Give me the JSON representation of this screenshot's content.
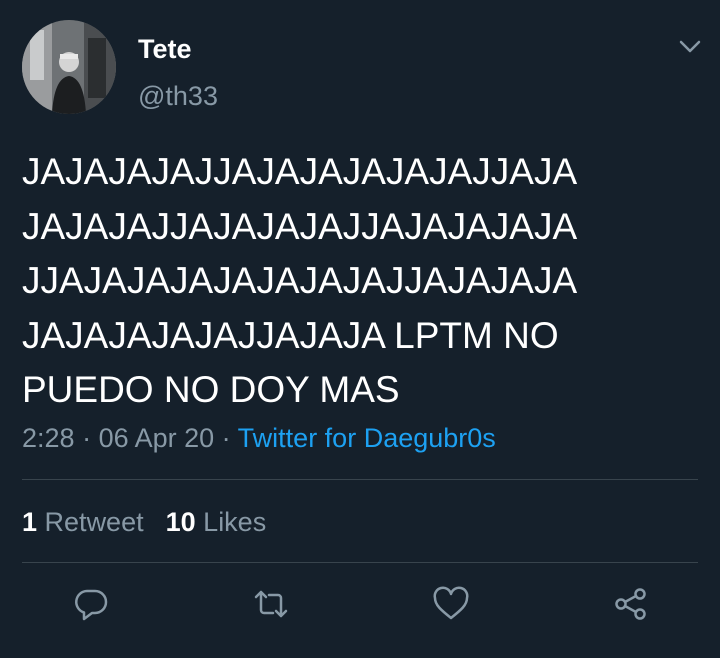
{
  "user": {
    "name": "Tete",
    "handle": "@th33"
  },
  "tweet": {
    "lines": [
      "JAJAJAJAJJAJAJAJAJAJAJJAJA",
      "JAJAJAJJAJAJAJAJJAJAJAJAJA",
      "JJAJAJAJAJAJAJAJAJJAJAJAJA",
      "JAJAJAJAJAJJAJAJA LPTM NO",
      "PUEDO NO DOY MAS"
    ]
  },
  "meta": {
    "time": "2:28",
    "separator": " · ",
    "date": "06 Apr 20",
    "source": "Twitter for Daegubr0s"
  },
  "stats": {
    "retweets_count": "1",
    "retweets_label": "Retweet",
    "likes_count": "10",
    "likes_label": "Likes"
  },
  "icons": {
    "reply": "reply-icon",
    "retweet": "retweet-icon",
    "like": "heart-icon",
    "share": "share-icon",
    "more": "chevron-down-icon"
  },
  "colors": {
    "background": "#15202b",
    "text": "#ffffff",
    "secondary": "#8899a6",
    "link": "#1da1f2",
    "divider": "#38444d"
  }
}
